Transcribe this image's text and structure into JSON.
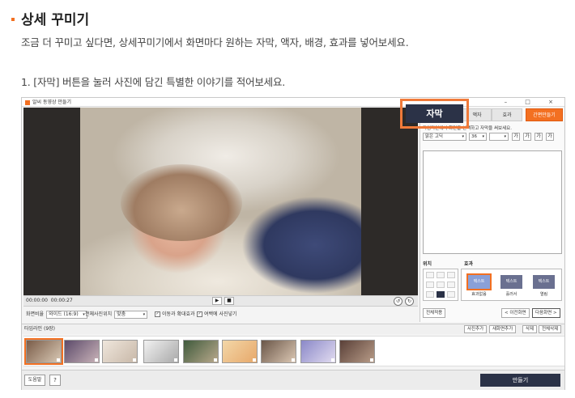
{
  "page": {
    "title": "상세 꾸미기",
    "intro": "조금 더 꾸미고 싶다면, 상세꾸미기에서 화면마다 원하는 자막, 액자, 배경, 효과를 넣어보세요.",
    "step": "1. [자막] 버튼을 눌러 사진에 담긴 특별한 이야기를 적어보세요."
  },
  "app": {
    "title": "알씨 동영상 만들기",
    "controls": "– □ ×",
    "time_current": "00:00:00",
    "time_total": "00:00:27",
    "play_icon": "▶",
    "stop_icon": "■",
    "options": {
      "ratio_label": "화면비율",
      "ratio_value": "와이드 (16:9)",
      "fit_label": "전체사진위치",
      "fit_value": "맞춤",
      "check1": "이동과 확대효과",
      "check2": "여백에 사진넣기"
    },
    "timeline": {
      "label": "타임라인 (9장)",
      "add_photo": "사진추가",
      "add_screen": "새화면추가",
      "delete": "삭제",
      "delete_all": "전체삭제"
    },
    "bottom": {
      "help": "도움말",
      "question": "?",
      "make": "만들기"
    }
  },
  "panel": {
    "tabs": [
      "자막",
      "액자",
      "효과",
      "간편만들기"
    ],
    "guide": "타임라인에서 화면을 선택하고 자막을 써보세요.",
    "font_value": "맑은 고딕",
    "size_value": "36",
    "style_buttons": [
      "가",
      "가",
      "가",
      "가"
    ],
    "position_label": "위치",
    "effect_label": "효과",
    "effects": [
      {
        "chip": "텍스트",
        "name": "효과없음"
      },
      {
        "chip": "텍스트",
        "name": "흘러서"
      },
      {
        "chip": "텍스트",
        "name": "열림"
      }
    ],
    "apply_all": "전체적용",
    "prev": "< 이전화면",
    "next": "다음화면 >"
  },
  "callout": {
    "label": "자막"
  }
}
